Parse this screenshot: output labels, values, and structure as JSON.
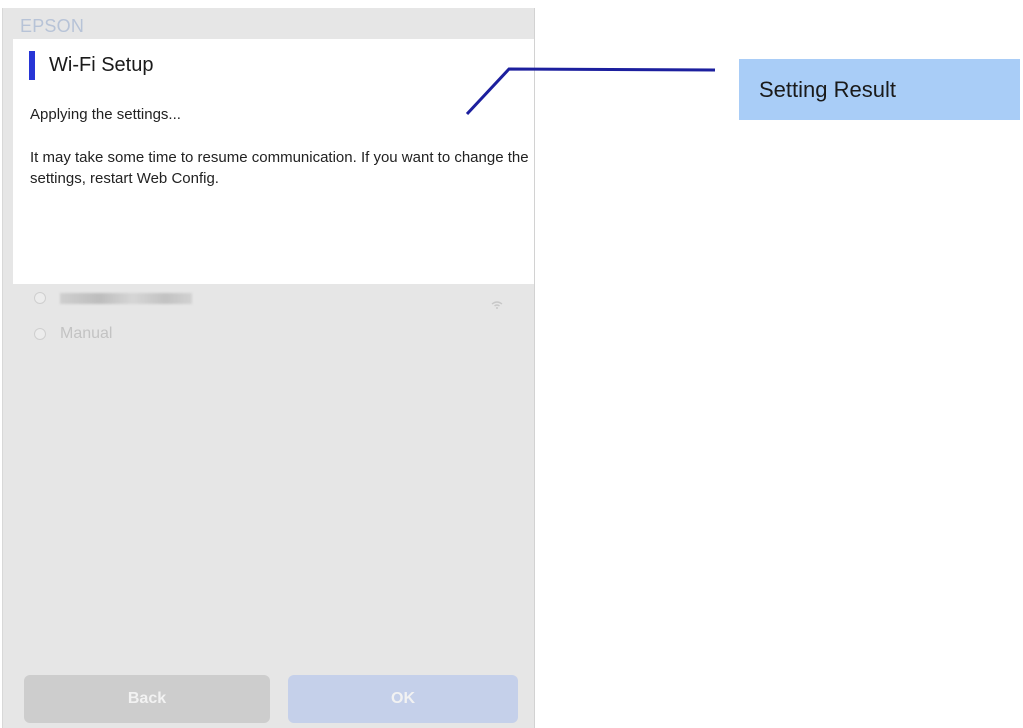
{
  "screen": {
    "brand": "EPSON",
    "dialog": {
      "title": "Wi-Fi Setup",
      "message_1": "Applying the settings...",
      "message_2": "It may take some time to resume communication. If you want to change the settings, restart Web Config."
    },
    "options": [
      {
        "label": "",
        "type": "network",
        "icon": "wifi-signal-icon"
      },
      {
        "label": "Manual",
        "type": "manual"
      }
    ],
    "buttons": {
      "back_label": "Back",
      "ok_label": "OK"
    }
  },
  "callout": {
    "label": "Setting Result",
    "box_color": "#a9cdf7",
    "line_color": "#1c1f9e"
  },
  "colors": {
    "accent_bar": "#2735d6",
    "brand_text": "#b7c3d7"
  }
}
